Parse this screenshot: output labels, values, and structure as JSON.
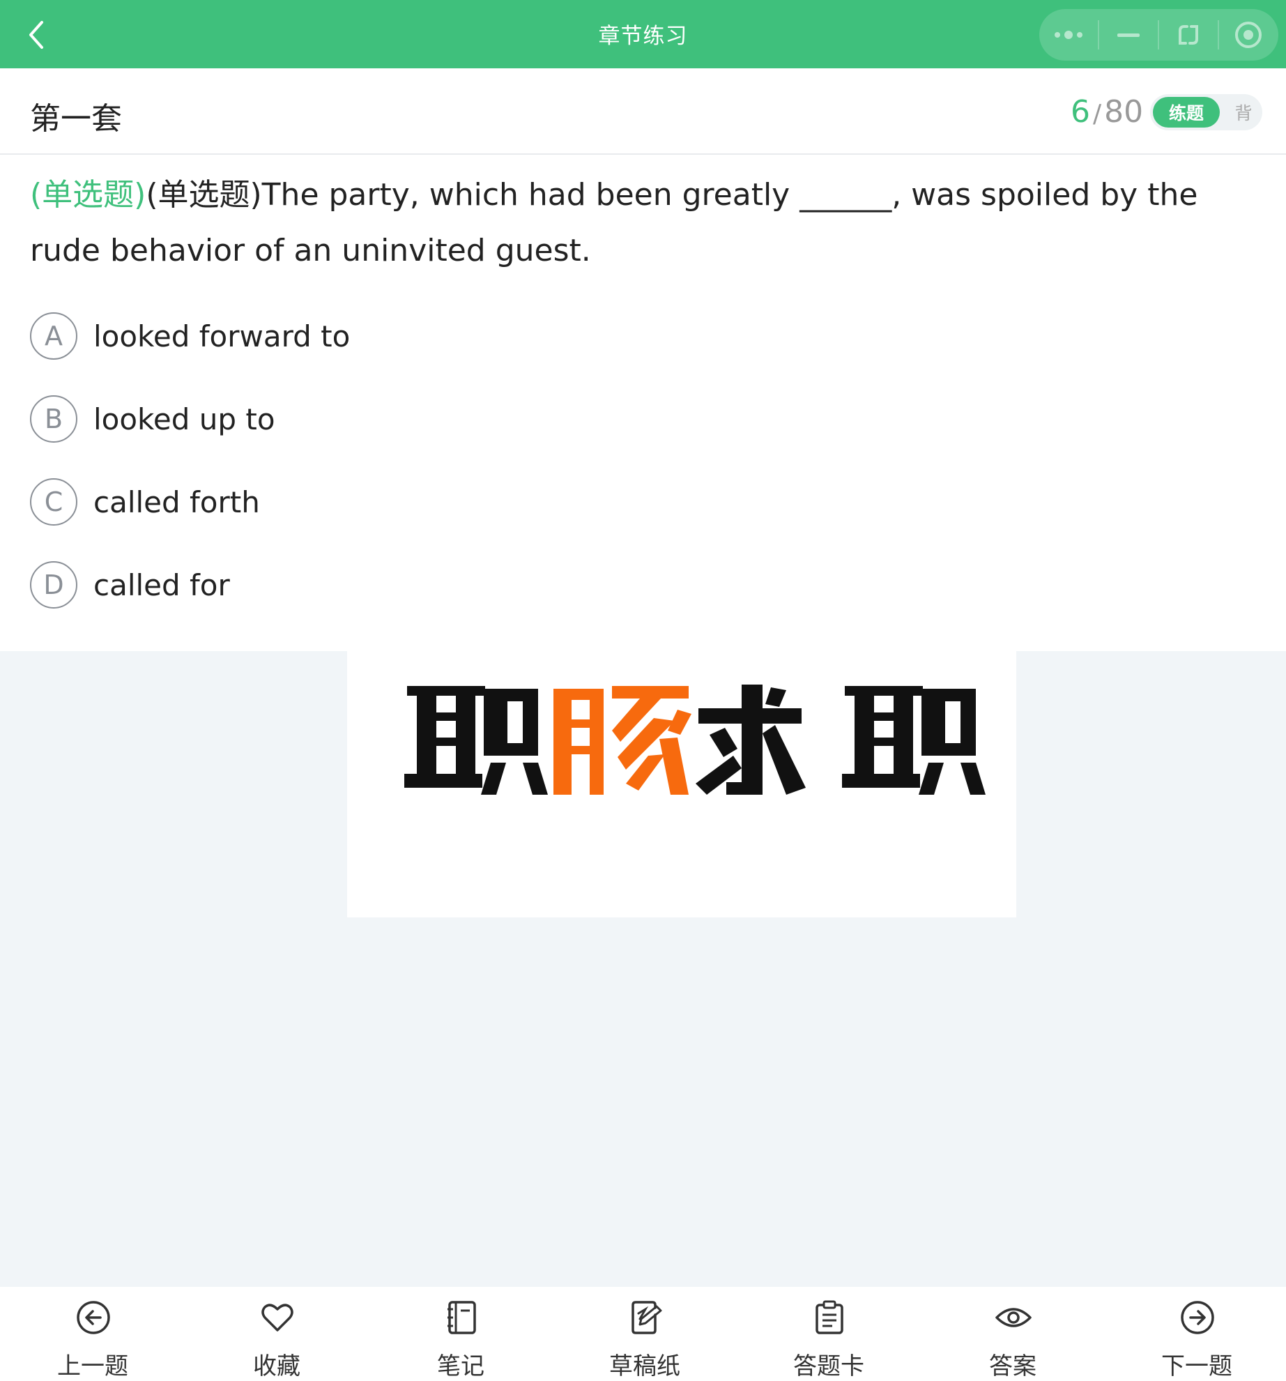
{
  "header": {
    "title": "章节练习",
    "icons": [
      "back-icon",
      "more-icon",
      "minimize-icon",
      "expand-icon",
      "close-target-icon"
    ],
    "accent_color": "#3fc07c"
  },
  "subheader": {
    "set_title": "第一套",
    "current": "6",
    "separator": "/",
    "total": "80",
    "mode_active": "练题",
    "mode_inactive": "背"
  },
  "question": {
    "type_label": "(单选题)",
    "stem": "(单选题)The party, which had been greatly ______, was spoiled by the rude behavior of an uninvited guest.",
    "options": [
      {
        "letter": "A",
        "text": "looked forward to"
      },
      {
        "letter": "B",
        "text": "looked up to"
      },
      {
        "letter": "C",
        "text": "called forth"
      },
      {
        "letter": "D",
        "text": "called for"
      }
    ]
  },
  "ad": {
    "chars": [
      "职",
      "豚",
      "求",
      "职"
    ],
    "colors": [
      "#111111",
      "#f76a0e",
      "#111111",
      "#111111"
    ]
  },
  "bottom_bar": {
    "items": [
      {
        "label": "上一题",
        "icon": "arrow-left-circle-icon"
      },
      {
        "label": "收藏",
        "icon": "heart-icon"
      },
      {
        "label": "笔记",
        "icon": "notebook-icon"
      },
      {
        "label": "草稿纸",
        "icon": "draft-paper-icon"
      },
      {
        "label": "答题卡",
        "icon": "clipboard-icon"
      },
      {
        "label": "答案",
        "icon": "eye-icon"
      },
      {
        "label": "下一题",
        "icon": "arrow-right-circle-icon"
      }
    ]
  }
}
